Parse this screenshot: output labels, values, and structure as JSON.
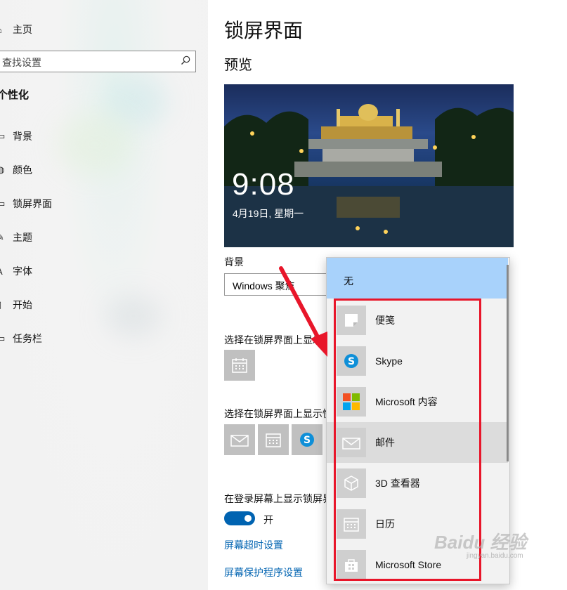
{
  "sidebar": {
    "home_label": "主页",
    "search_placeholder": "查找设置",
    "group_title": "个性化",
    "items": [
      {
        "label": "背景",
        "icon": "image-icon"
      },
      {
        "label": "颜色",
        "icon": "palette-icon"
      },
      {
        "label": "锁屏界面",
        "icon": "monitor-icon"
      },
      {
        "label": "主题",
        "icon": "brush-icon"
      },
      {
        "label": "字体",
        "icon": "font-icon"
      },
      {
        "label": "开始",
        "icon": "start-icon"
      },
      {
        "label": "任务栏",
        "icon": "taskbar-icon"
      }
    ]
  },
  "main": {
    "title": "锁屏界面",
    "preview_heading": "预览",
    "clock": "9:08",
    "date": "4月19日, 星期一",
    "background_label": "背景",
    "background_value": "Windows 聚焦",
    "detailed_status_label": "选择在锁屏界面上显示详细状态的应用",
    "quick_status_label": "选择在锁屏界面上显示快速状态的应用",
    "signin_label": "在登录屏幕上显示锁屏界面背景图片",
    "toggle_state": "开",
    "link_timeout": "屏幕超时设置",
    "link_screensaver": "屏幕保护程序设置"
  },
  "dropdown": {
    "none_label": "无",
    "items": [
      {
        "label": "便笺",
        "icon": "sticky-notes-icon"
      },
      {
        "label": "Skype",
        "icon": "skype-icon"
      },
      {
        "label": "Microsoft 内容",
        "icon": "microsoft-logo-icon"
      },
      {
        "label": "邮件",
        "icon": "mail-icon"
      },
      {
        "label": "3D 查看器",
        "icon": "cube-icon"
      },
      {
        "label": "日历",
        "icon": "calendar-icon"
      },
      {
        "label": "Microsoft Store",
        "icon": "store-icon"
      }
    ]
  },
  "watermark": {
    "brand": "Baidu 经验",
    "url": "jingyan.baidu.com"
  },
  "colors": {
    "accent": "#0063b1",
    "highlight": "#a8d2fb",
    "annotation_red": "#e8162a"
  }
}
